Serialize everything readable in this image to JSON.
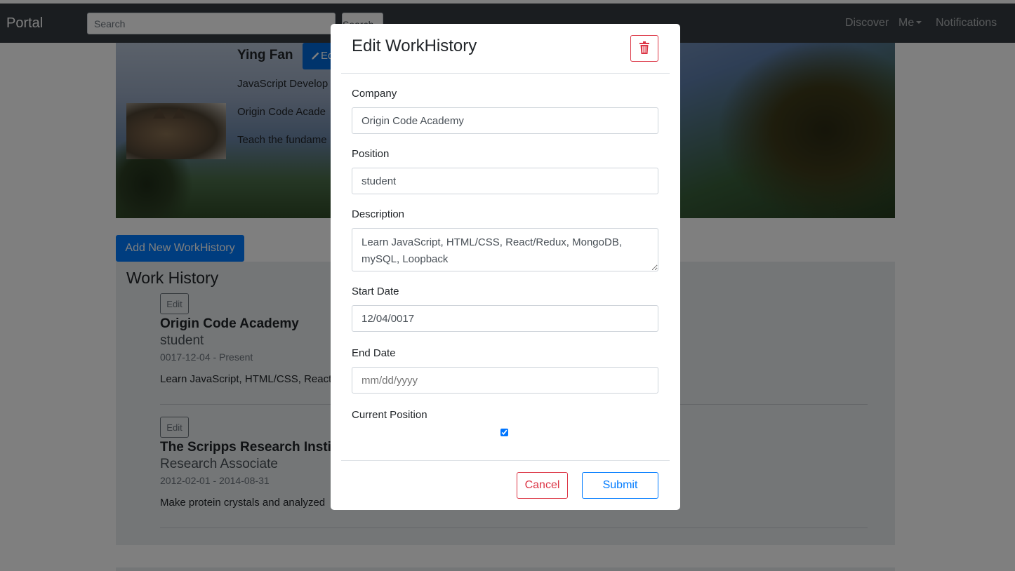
{
  "navbar": {
    "brand": "Portal",
    "search_placeholder": "Search",
    "search_button": "Search",
    "links": [
      "Discover",
      "Me",
      "Notifications"
    ]
  },
  "profile": {
    "name": "Ying Fan",
    "edit_label": "Ed",
    "title": "JavaScript Develop",
    "company": "Origin Code Acade",
    "about": "Teach the fundame"
  },
  "work_history": {
    "add_button": "Add New WorkHistory",
    "section_title": "Work History",
    "edit_label": "Edit",
    "items": [
      {
        "company": "Origin Code Academy",
        "position": "student",
        "dates": "0017-12-04 - Present",
        "description": "Learn JavaScript, HTML/CSS, React,"
      },
      {
        "company": "The Scripps Research Instit",
        "position": "Research Associate",
        "dates": "2012-02-01 - 2014-08-31",
        "description": "Make protein crystals and analyzed"
      }
    ]
  },
  "modal": {
    "title": "Edit WorkHistory",
    "fields": {
      "company": {
        "label": "Company",
        "value": "Origin Code Academy"
      },
      "position": {
        "label": "Position",
        "value": "student"
      },
      "description": {
        "label": "Description",
        "value": "Learn JavaScript, HTML/CSS, React/Redux, MongoDB, mySQL, Loopback"
      },
      "start_date": {
        "label": "Start Date",
        "value": "12/04/0017"
      },
      "end_date": {
        "label": "End Date",
        "placeholder": "mm/dd/yyyy"
      },
      "current_position": {
        "label": "Current Position",
        "checked": true
      }
    },
    "cancel_button": "Cancel",
    "submit_button": "Submit"
  },
  "colors": {
    "navbar": "#343a40",
    "primary": "#007bff",
    "danger": "#dc3545",
    "card_bg": "#e9ecef"
  },
  "icons": {
    "delete": "trash-icon",
    "edit_profile": "pencil-icon"
  }
}
